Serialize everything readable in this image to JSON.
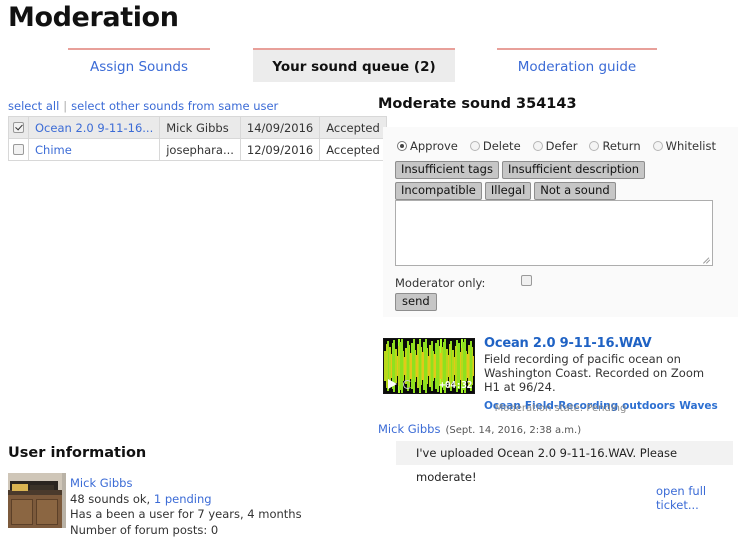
{
  "header": {
    "title": "Moderation"
  },
  "tabs": [
    {
      "label": "Assign Sounds",
      "active": false
    },
    {
      "label": "Your sound queue (2)",
      "active": true
    },
    {
      "label": "Moderation guide",
      "active": false
    }
  ],
  "queue": {
    "links": {
      "select_all": "select all",
      "separator": "|",
      "select_same_user": "select other sounds from same user"
    },
    "rows": [
      {
        "checked": true,
        "name": "Ocean 2.0 9-11-16...",
        "user": "Mick Gibbs",
        "date": "14/09/2016",
        "state": "Accepted"
      },
      {
        "checked": false,
        "name": "Chime",
        "user": "josephara...",
        "date": "12/09/2016",
        "state": "Accepted"
      }
    ]
  },
  "user_information": {
    "heading": "User information",
    "username": "Mick Gibbs",
    "sounds_ok": "48 sounds ok,",
    "pending": "1 pending",
    "member_since": "Has a been a user for 7 years, 4 months",
    "forum_posts": "Number of forum posts: 0"
  },
  "moderate": {
    "title": "Moderate sound 354143",
    "actions": [
      {
        "label": "Approve",
        "selected": true
      },
      {
        "label": "Delete",
        "selected": false
      },
      {
        "label": "Defer",
        "selected": false
      },
      {
        "label": "Return",
        "selected": false
      },
      {
        "label": "Whitelist",
        "selected": false
      }
    ],
    "reasons": [
      "Insufficient tags",
      "Insufficient description",
      "Incompatible",
      "Illegal",
      "Not a sound"
    ],
    "comment_value": "",
    "comment_placeholder": "",
    "moderator_only_label": "Moderator only:",
    "moderator_only_checked": false,
    "send_label": "send"
  },
  "sound": {
    "name": "Ocean 2.0 9-11-16.WAV",
    "description": "Field recording of pacific ocean on Washington Coast. Recorded on Zoom H1 at 96/24.",
    "tags": [
      "Ocean",
      "Field-Recording",
      "outdoors",
      "Waves"
    ],
    "duration": "+04:32",
    "play_icon": "play-icon",
    "loop_icon": "loop-icon",
    "moderation_state": "Moderation state: Pending"
  },
  "ticket": {
    "author": "Mick Gibbs",
    "timestamp": "(Sept. 14, 2016, 2:38 a.m.)",
    "message": "I've uploaded Ocean 2.0 9-11-16.WAV. Please moderate!",
    "open_full": "open full ticket..."
  },
  "colors": {
    "tab_accent": "#e8a09a",
    "link": "#3b6bd6",
    "sound_link": "#1f62c4",
    "active_tab_bg": "#ececec"
  }
}
